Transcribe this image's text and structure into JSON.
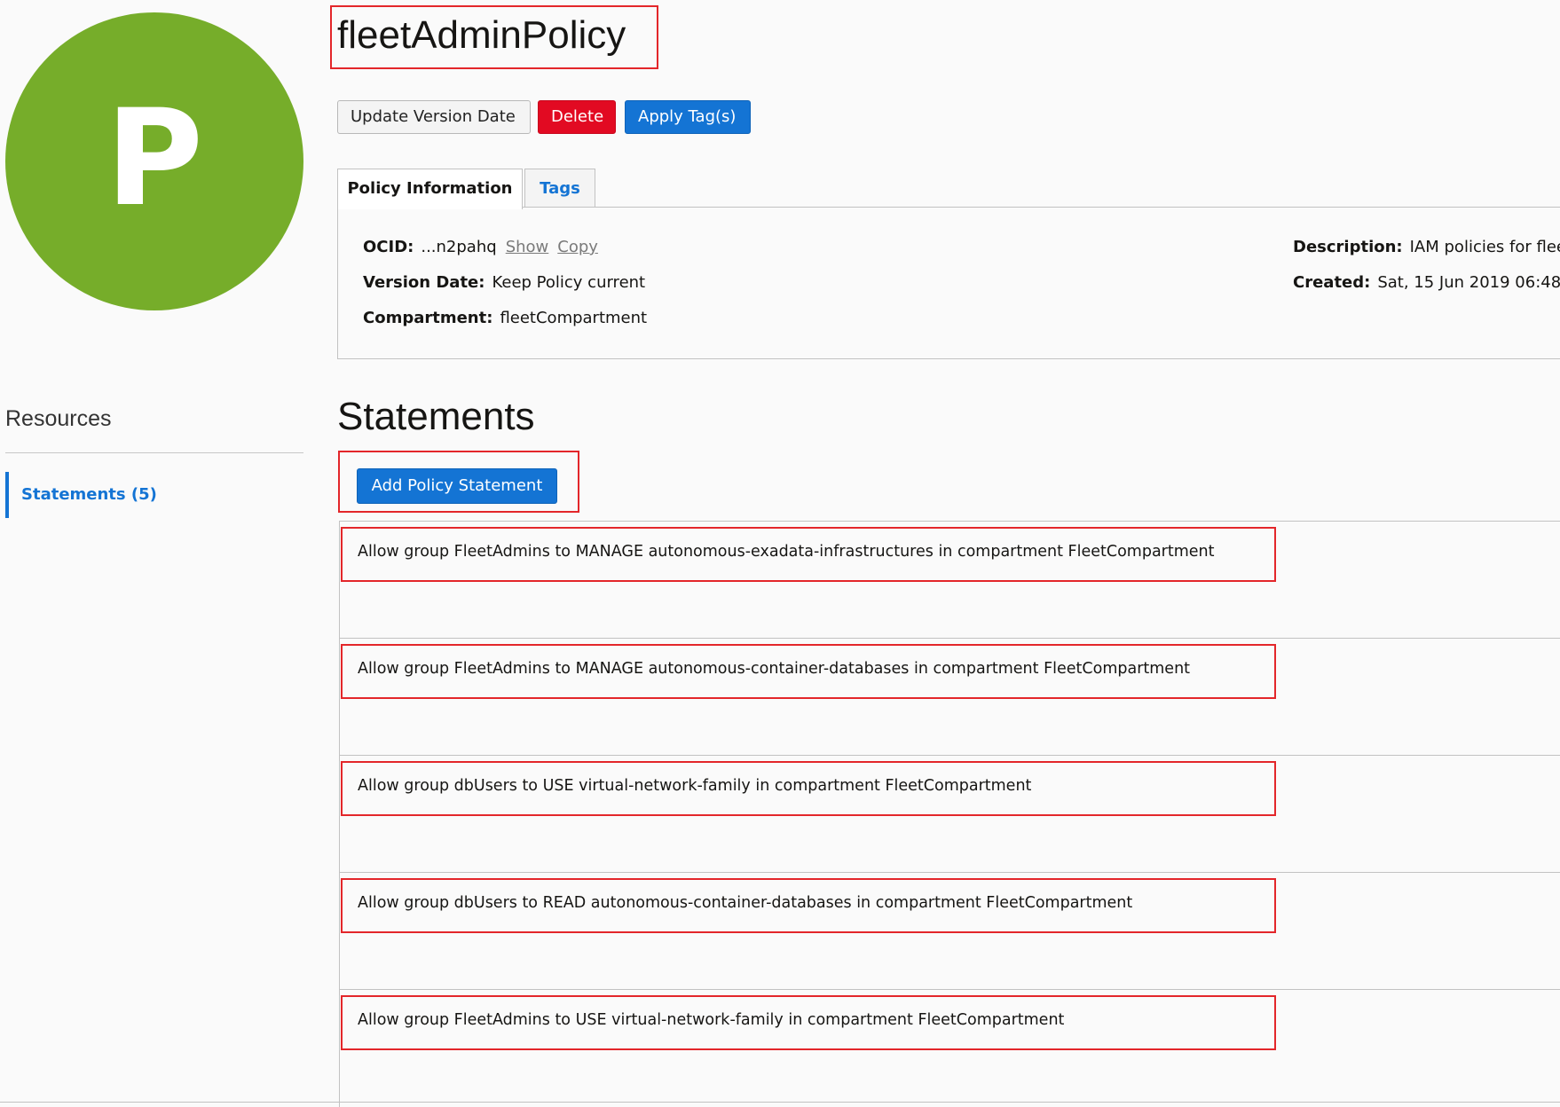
{
  "avatar": {
    "letter": "P",
    "color": "#76ad2a"
  },
  "title": "fleetAdminPolicy",
  "actions": {
    "update_version_date": "Update Version Date",
    "delete": "Delete",
    "apply_tags": "Apply Tag(s)"
  },
  "tabs": [
    {
      "label": "Policy Information",
      "active": true
    },
    {
      "label": "Tags",
      "active": false
    }
  ],
  "policy_info": {
    "ocid_label": "OCID:",
    "ocid_value": "...n2pahq",
    "show_link": "Show",
    "copy_link": "Copy",
    "version_date_label": "Version Date:",
    "version_date_value": "Keep Policy current",
    "compartment_label": "Compartment:",
    "compartment_value": "fleetCompartment",
    "description_label": "Description:",
    "description_value": "IAM policies for flee",
    "created_label": "Created:",
    "created_value": "Sat, 15 Jun 2019 06:48"
  },
  "resources": {
    "heading": "Resources",
    "items": [
      {
        "label": "Statements (5)",
        "active": true
      }
    ]
  },
  "statements": {
    "heading": "Statements",
    "add_button": "Add Policy Statement",
    "rows": [
      "Allow group FleetAdmins to MANAGE autonomous-exadata-infrastructures in compartment FleetCompartment",
      "Allow group FleetAdmins to MANAGE autonomous-container-databases in compartment FleetCompartment",
      "Allow group dbUsers to USE virtual-network-family in compartment FleetCompartment",
      "Allow group dbUsers to READ autonomous-container-databases in compartment FleetCompartment",
      "Allow group FleetAdmins to USE virtual-network-family in compartment FleetCompartment"
    ]
  },
  "colors": {
    "primary": "#1474d4",
    "danger": "#e20a22",
    "highlight": "#e3262a"
  }
}
